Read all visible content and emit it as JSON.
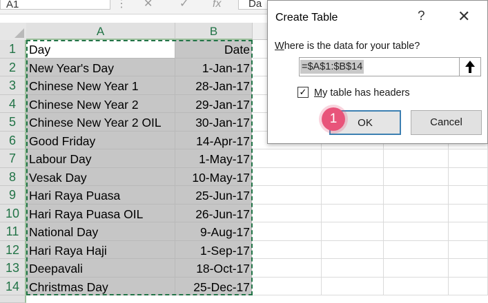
{
  "formula_bar": {
    "name_box": "A1",
    "cancel_glyph": "✕",
    "enter_glyph": "✓",
    "fx_label": "fx",
    "formula_value": "Da"
  },
  "sheet": {
    "columns": [
      "A",
      "B"
    ],
    "row_numbers": [
      "1",
      "2",
      "3",
      "4",
      "5",
      "6",
      "7",
      "8",
      "9",
      "10",
      "11",
      "12",
      "13",
      "14"
    ],
    "rows": [
      {
        "a": "Day",
        "b": "Date"
      },
      {
        "a": "New Year's Day",
        "b": "1-Jan-17"
      },
      {
        "a": "Chinese New Year 1",
        "b": "28-Jan-17"
      },
      {
        "a": "Chinese New Year 2",
        "b": "29-Jan-17"
      },
      {
        "a": "Chinese New Year 2 OIL",
        "b": "30-Jan-17"
      },
      {
        "a": "Good Friday",
        "b": "14-Apr-17"
      },
      {
        "a": "Labour Day",
        "b": "1-May-17"
      },
      {
        "a": "Vesak Day",
        "b": "10-May-17"
      },
      {
        "a": "Hari Raya Puasa",
        "b": "25-Jun-17"
      },
      {
        "a": "Hari Raya Puasa OIL",
        "b": "26-Jun-17"
      },
      {
        "a": "National Day",
        "b": "9-Aug-17"
      },
      {
        "a": "Hari Raya Haji",
        "b": "1-Sep-17"
      },
      {
        "a": "Deepavali",
        "b": "18-Oct-17"
      },
      {
        "a": "Christmas Day",
        "b": "25-Dec-17"
      }
    ]
  },
  "dialog": {
    "title": "Create Table",
    "help_glyph": "?",
    "close_glyph": "✕",
    "question_first": "W",
    "question_rest": "here is the data for your table?",
    "range_value": "=$A$1:$B$14",
    "checkbox_checked": true,
    "checkbox_glyph": "✓",
    "checkbox_label_first": "M",
    "checkbox_label_rest": "y table has headers",
    "ok_label": "OK",
    "cancel_label": "Cancel"
  },
  "step_badge": "1",
  "colors": {
    "accent_green": "#217346",
    "selection_gray": "#c6c6c6",
    "badge_pink": "#e8547a",
    "ok_border_blue": "#3c7fb1"
  },
  "icons": [
    "collapse-dialog-icon",
    "checkbox-checked-icon",
    "close-icon",
    "help-icon"
  ]
}
